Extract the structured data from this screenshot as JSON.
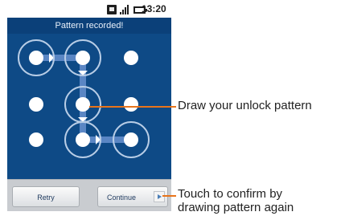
{
  "status_bar": {
    "time": "13:20",
    "icons": [
      "sim-icon",
      "signal-icon",
      "battery-icon"
    ]
  },
  "screen": {
    "header": "Pattern recorded!",
    "pattern": {
      "grid": "3x3",
      "sequence": [
        [
          0,
          0
        ],
        [
          0,
          1
        ],
        [
          1,
          1
        ],
        [
          2,
          1
        ],
        [
          2,
          2
        ]
      ]
    }
  },
  "bottom_bar": {
    "retry_label": "Retry",
    "continue_label": "Continue"
  },
  "annotations": {
    "pattern_callout": "Draw your unlock pattern",
    "confirm_callout_line1": "Touch to confirm by",
    "confirm_callout_line2": "drawing pattern again"
  },
  "colors": {
    "screen_bg": "#0e4a86",
    "callout_line": "#e8741a",
    "dot": "#ffffff",
    "pattern_line": "#5a86c4"
  }
}
